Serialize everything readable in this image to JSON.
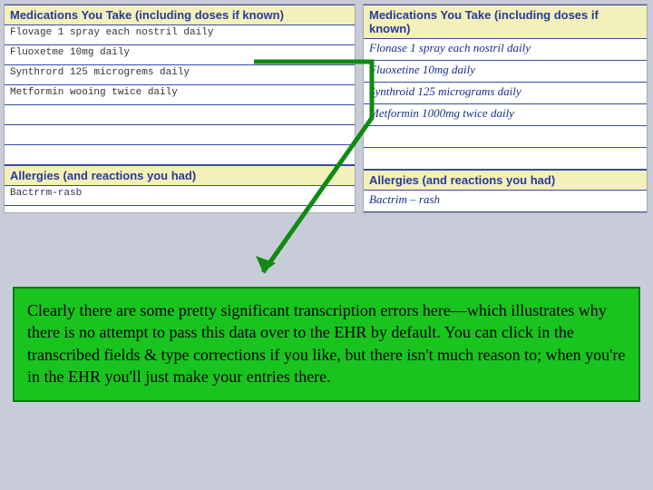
{
  "left": {
    "meds_header": "Medications You Take (including doses if known)",
    "rows": [
      "Flovage 1 spray each nostril daily",
      "Fluoxetme 10mg daily",
      "Synthrord 125 microgrems daily",
      "Metformin wooing twice daily",
      "",
      "",
      ""
    ],
    "allergies_header": "Allergies (and reactions you had)",
    "allergy_rows": [
      "Bactrrm-rasb"
    ]
  },
  "right": {
    "meds_header": "Medications You Take (including doses if known)",
    "rows": [
      "Flonase  1 spray each nostril  daily",
      "Fluoxetine 10mg daily",
      "Synthroid  125 micrograms daily",
      "Metformin  1000mg  twice daily",
      "",
      ""
    ],
    "allergies_header": "Allergies (and reactions you had)",
    "allergy_rows": [
      "Bactrim – rash"
    ]
  },
  "callout": "Clearly there are some pretty significant transcription errors here—which illustrates why there is no attempt to pass this data over to the EHR by default.  You can click in the transcribed fields & type corrections if you like, but there isn't much reason to; when you're in the EHR you'll just make your entries there."
}
